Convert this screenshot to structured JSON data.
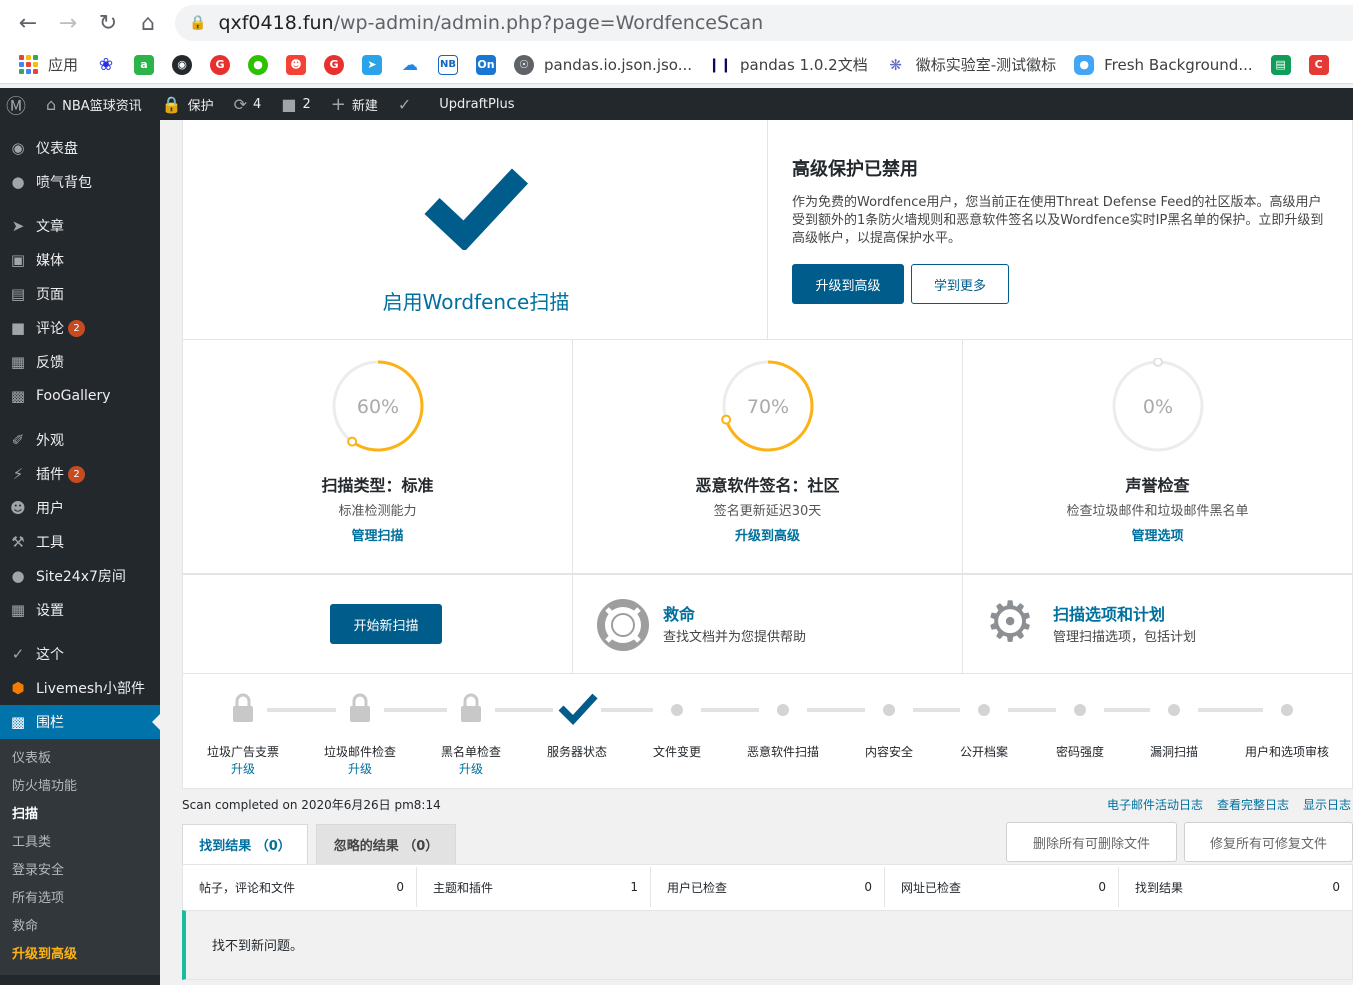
{
  "browser": {
    "url_host": "qxf0418.fun",
    "url_path": "/wp-admin/admin.php?page=WordfenceScan",
    "bookmarks": [
      {
        "icon": "apps-icon",
        "label": "应用"
      },
      {
        "icon": "baidu-paw-icon",
        "label": ""
      },
      {
        "icon": "a-icon",
        "label": ""
      },
      {
        "icon": "github-icon",
        "label": ""
      },
      {
        "icon": "red-g-icon",
        "label": ""
      },
      {
        "icon": "wechat-icon",
        "label": ""
      },
      {
        "icon": "red-face-icon",
        "label": ""
      },
      {
        "icon": "red-g2-icon",
        "label": ""
      },
      {
        "icon": "paper-plane-icon",
        "label": ""
      },
      {
        "icon": "cloud-icon",
        "label": ""
      },
      {
        "icon": "nb-icon",
        "label": ""
      },
      {
        "icon": "on-icon",
        "label": ""
      },
      {
        "icon": "globe-icon",
        "label": "pandas.io.json.jso..."
      },
      {
        "icon": "pandas-icon",
        "label": "pandas 1.0.2文档"
      },
      {
        "icon": "badge-lab-icon",
        "label": "徽标实验室-测试徽标"
      },
      {
        "icon": "fresh-bg-icon",
        "label": "Fresh Background..."
      },
      {
        "icon": "green-doc-icon",
        "label": ""
      },
      {
        "icon": "red-c-icon",
        "label": ""
      }
    ]
  },
  "adminbar": {
    "site": "NBA篮球资讯",
    "protect": "保护",
    "updates": "4",
    "comments": "2",
    "new": "新建",
    "updraft": "UpdraftPlus"
  },
  "sidebar": {
    "items": [
      {
        "icon": "dashboard-icon",
        "label": "仪表盘",
        "badge": ""
      },
      {
        "icon": "jetpack-icon",
        "label": "喷气背包",
        "badge": ""
      },
      {
        "icon": "pin-icon",
        "label": "文章",
        "badge": ""
      },
      {
        "icon": "media-icon",
        "label": "媒体",
        "badge": ""
      },
      {
        "icon": "page-icon",
        "label": "页面",
        "badge": ""
      },
      {
        "icon": "comment-icon",
        "label": "评论",
        "badge": "2"
      },
      {
        "icon": "feedback-icon",
        "label": "反馈",
        "badge": ""
      },
      {
        "icon": "gallery-icon",
        "label": "FooGallery",
        "badge": ""
      },
      {
        "icon": "brush-icon",
        "label": "外观",
        "badge": ""
      },
      {
        "icon": "plugin-icon",
        "label": "插件",
        "badge": "2"
      },
      {
        "icon": "user-icon",
        "label": "用户",
        "badge": ""
      },
      {
        "icon": "wrench-icon",
        "label": "工具",
        "badge": ""
      },
      {
        "icon": "site24x7-icon",
        "label": "Site24x7房间",
        "badge": ""
      },
      {
        "icon": "settings-icon",
        "label": "设置",
        "badge": ""
      },
      {
        "icon": "yoast-icon",
        "label": "这个",
        "badge": ""
      },
      {
        "icon": "livemesh-icon",
        "label": "Livemesh小部件",
        "badge": ""
      },
      {
        "icon": "wordfence-icon",
        "label": "围栏",
        "badge": ""
      }
    ],
    "submenu": [
      "仪表板",
      "防火墙功能",
      "扫描",
      "工具类",
      "登录安全",
      "所有选项",
      "救命",
      "升级到高级"
    ]
  },
  "scan_card": {
    "label": "启用Wordfence扫描"
  },
  "premium": {
    "title": "高级保护已禁用",
    "body": "作为免费的Wordfence用户，您当前正在使用Threat Defense Feed的社区版本。高级用户受到额外的1条防火墙规则和恶意软件签名以及Wordfence实时IP黑名单的保护。立即升级到高级帐户，以提高保护水平。",
    "upgrade_btn": "升级到高级",
    "learn_btn": "学到更多"
  },
  "stats": [
    {
      "pct_label": "60%",
      "pct": 0.6,
      "title": "扫描类型：标准",
      "sub": "标准检测能力",
      "link": "管理扫描"
    },
    {
      "pct_label": "70%",
      "pct": 0.7,
      "title": "恶意软件签名：社区",
      "sub": "签名更新延迟30天",
      "link": "升级到高级"
    },
    {
      "pct_label": "0%",
      "pct": 0.0,
      "title": "声誉检查",
      "sub": "检查垃圾邮件和垃圾邮件黑名单",
      "link": "管理选项"
    }
  ],
  "actions": {
    "start_scan": "开始新扫描",
    "help_title": "救命",
    "help_sub": "查找文档并为您提供帮助",
    "options_title": "扫描选项和计划",
    "options_sub": "管理扫描选项，包括计划"
  },
  "steps": [
    {
      "label": "垃圾广告支票",
      "sub": "升级",
      "state": "locked"
    },
    {
      "label": "垃圾邮件检查",
      "sub": "升级",
      "state": "locked"
    },
    {
      "label": "黑名单检查",
      "sub": "升级",
      "state": "locked"
    },
    {
      "label": "服务器状态",
      "sub": "",
      "state": "done"
    },
    {
      "label": "文件变更",
      "sub": "",
      "state": "pending"
    },
    {
      "label": "恶意软件扫描",
      "sub": "",
      "state": "pending"
    },
    {
      "label": "内容安全",
      "sub": "",
      "state": "pending"
    },
    {
      "label": "公开档案",
      "sub": "",
      "state": "pending"
    },
    {
      "label": "密码强度",
      "sub": "",
      "state": "pending"
    },
    {
      "label": "漏洞扫描",
      "sub": "",
      "state": "pending"
    },
    {
      "label": "用户和选项审核",
      "sub": "",
      "state": "pending"
    }
  ],
  "scan_status": {
    "completed": "Scan completed on 2020年6月26日 pm8:14",
    "email_log": "电子邮件活动日志",
    "full_log": "查看完整日志",
    "show_log": "显示日志"
  },
  "results": {
    "tab_found": "找到结果 （0）",
    "tab_ignored": "忽略的结果 （0）",
    "delete_btn": "删除所有可删除文件",
    "repair_btn": "修复所有可修复文件",
    "summary": [
      {
        "label": "帖子，评论和文件",
        "value": "0"
      },
      {
        "label": "主题和插件",
        "value": "1"
      },
      {
        "label": "用户已检查",
        "value": "0"
      },
      {
        "label": "网址已检查",
        "value": "0"
      },
      {
        "label": "找到结果",
        "value": "0"
      }
    ],
    "no_issues": "找不到新问题。"
  },
  "colors": {
    "wp_blue": "#0073aa",
    "wf_blue": "#005c8a",
    "gauge_orange": "#fcb214",
    "teal": "#16bc9b"
  }
}
